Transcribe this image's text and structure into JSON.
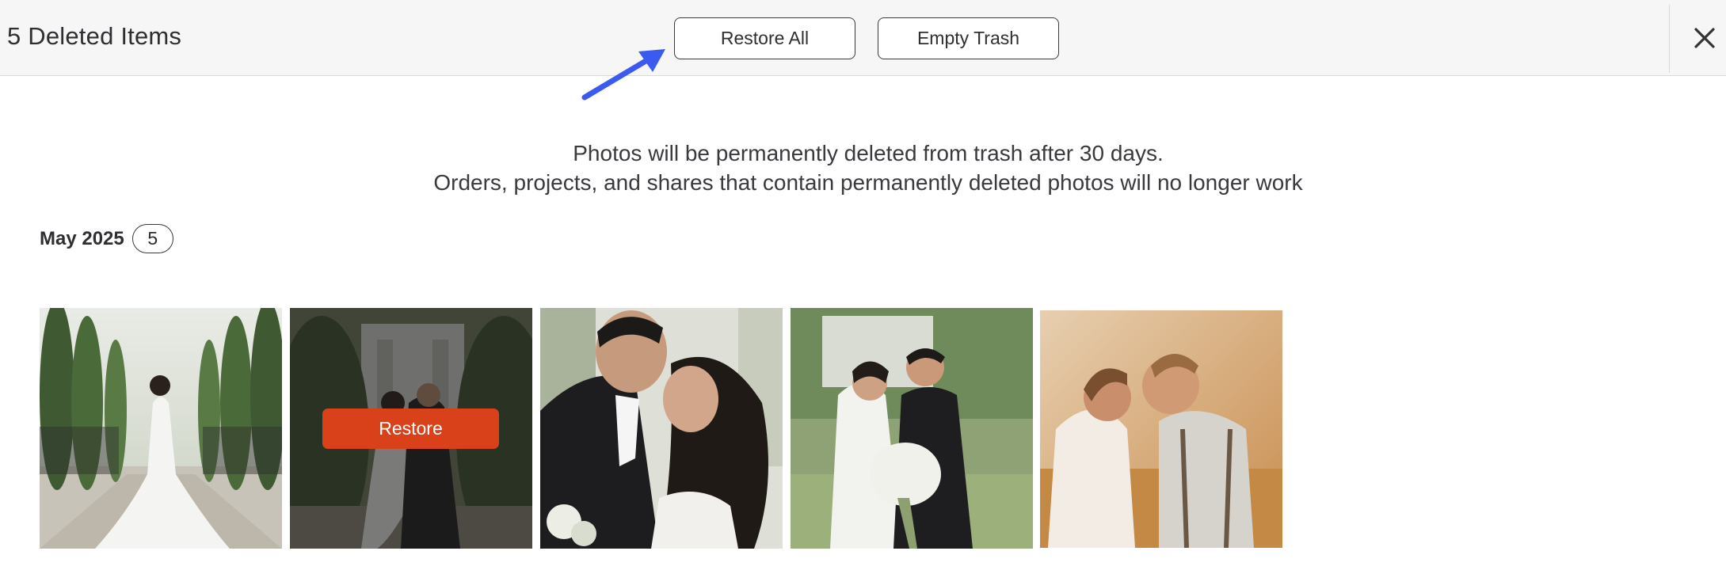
{
  "header": {
    "title": "5 Deleted Items",
    "restore_all_label": "Restore All",
    "empty_trash_label": "Empty Trash",
    "close_icon": "close-icon"
  },
  "notice": {
    "line1": "Photos will be permanently deleted from trash after 30 days.",
    "line2": "Orders, projects, and shares that contain permanently deleted photos will no longer work"
  },
  "group": {
    "title": "May 2025",
    "count": "5"
  },
  "photos": {
    "hover_restore_label": "Restore"
  },
  "colors": {
    "accent_orange": "#d9411b",
    "annotation_arrow": "#3b5bf0"
  }
}
